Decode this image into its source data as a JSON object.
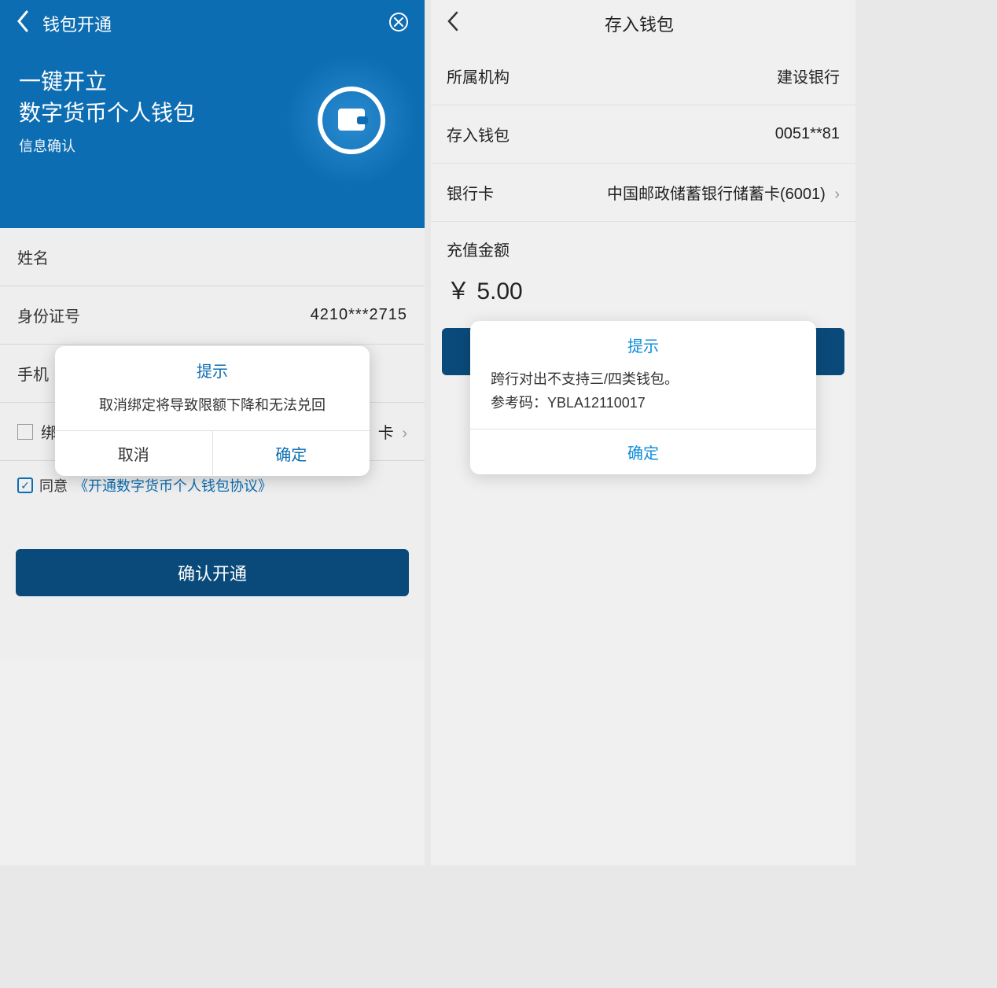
{
  "left": {
    "header": {
      "title": "钱包开通",
      "back_icon": "chevron-left",
      "close_icon": "close"
    },
    "hero": {
      "line1": "一键开立",
      "line2": "数字货币个人钱包",
      "subtitle": "信息确认"
    },
    "form": {
      "name_label": "姓名",
      "name_value": "",
      "id_label": "身份证号",
      "id_value": "4210***2715",
      "phone_label": "手机",
      "phone_value": "",
      "bind_label": "绑",
      "bind_value": "卡",
      "agree_checked": true,
      "agree_text": "同意",
      "agree_link": "《开通数字货币个人钱包协议》",
      "submit": "确认开通"
    },
    "dialog": {
      "title": "提示",
      "body": "取消绑定将导致限额下降和无法兑回",
      "cancel": "取消",
      "confirm": "确定"
    }
  },
  "right": {
    "header": {
      "title": "存入钱包"
    },
    "rows": {
      "org_label": "所属机构",
      "org_value": "建设银行",
      "wallet_label": "存入钱包",
      "wallet_value": "0051**81",
      "card_label": "银行卡",
      "card_value": "中国邮政储蓄银行储蓄卡(6001)"
    },
    "amount_label": "充值金额",
    "amount_value": "￥ 5.00",
    "dialog": {
      "title": "提示",
      "body_line1": "跨行对出不支持三/四类钱包。",
      "body_line2": "参考码：YBLA12110017",
      "confirm": "确定"
    }
  }
}
